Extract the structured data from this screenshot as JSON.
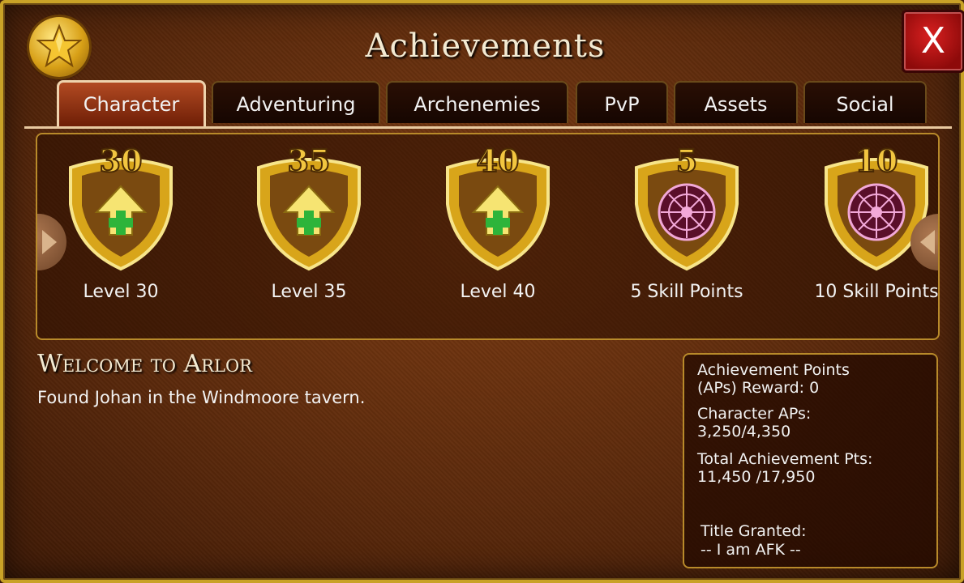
{
  "window": {
    "title": "Achievements",
    "close_label": "X"
  },
  "tabs": [
    {
      "label": "Character",
      "active": true
    },
    {
      "label": "Adventuring",
      "active": false
    },
    {
      "label": "Archenemies",
      "active": false
    },
    {
      "label": "PvP",
      "active": false
    },
    {
      "label": "Assets",
      "active": false
    },
    {
      "label": "Social",
      "active": false
    }
  ],
  "achievements": [
    {
      "badge": "30",
      "label": "Level 30",
      "icon": "level-up-arrow-icon"
    },
    {
      "badge": "35",
      "label": "Level 35",
      "icon": "level-up-arrow-icon"
    },
    {
      "badge": "40",
      "label": "Level 40",
      "icon": "level-up-arrow-icon"
    },
    {
      "badge": "5",
      "label": "5 Skill Points",
      "icon": "skill-rune-icon"
    },
    {
      "badge": "10",
      "label": "10 Skill Points",
      "icon": "skill-rune-icon"
    }
  ],
  "selected": {
    "title": "Welcome to Arlor",
    "description": "Found Johan in the Windmoore tavern."
  },
  "points": {
    "reward_line1": "Achievement Points",
    "reward_line2": "(APs) Reward: 0",
    "character_label": "Character APs:",
    "character_value": "3,250/4,350",
    "total_label": "Total Achievement Pts:",
    "total_value": "11,450 /17,950",
    "title_label": "Title Granted:",
    "title_value": "-- I am AFK --"
  },
  "colors": {
    "accent_gold": "#c9a227",
    "close_red": "#b01010",
    "panel_brown": "#5c2a0c"
  }
}
